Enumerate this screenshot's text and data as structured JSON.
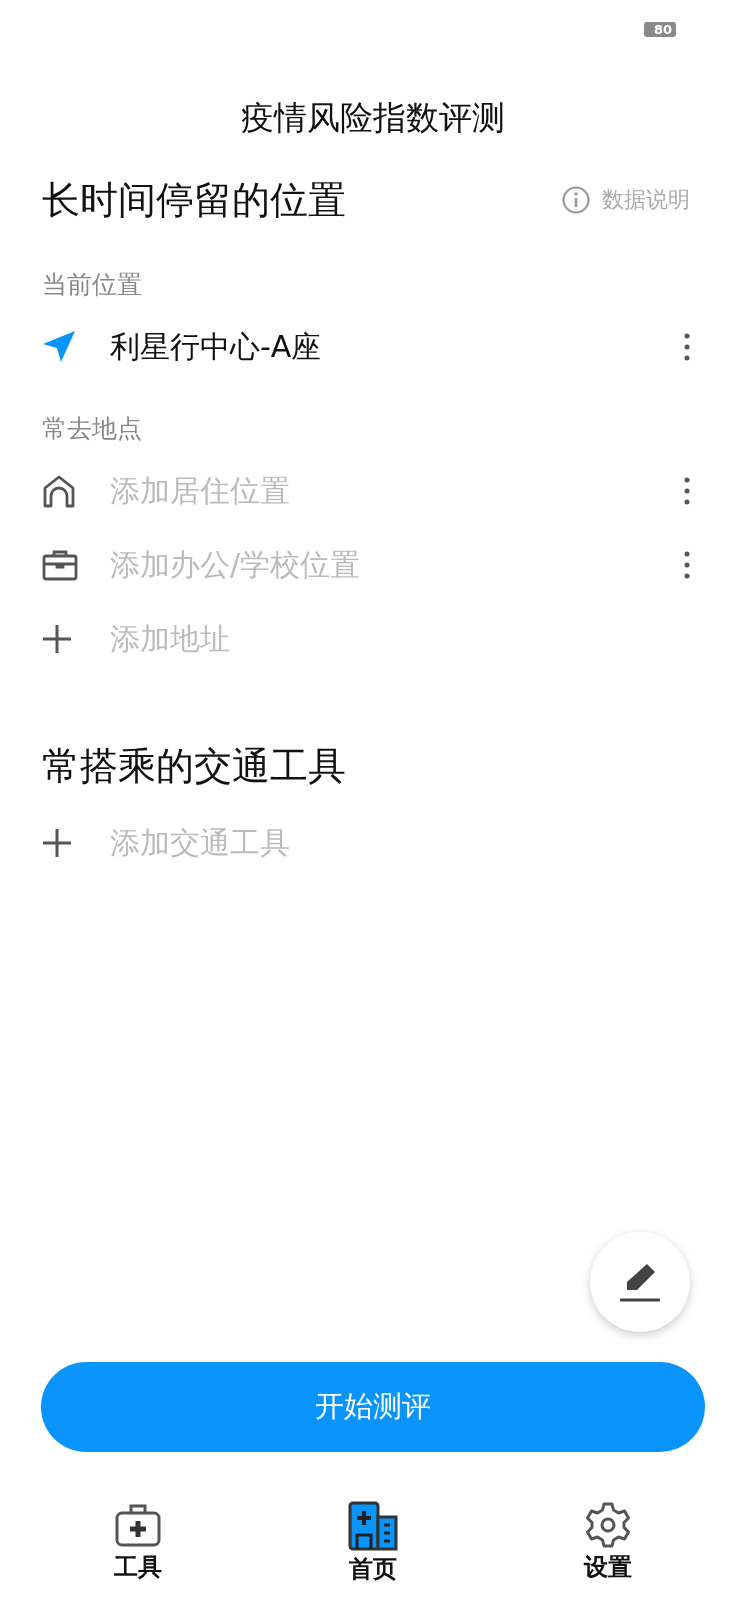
{
  "status_bar": {
    "battery": "80"
  },
  "title": "疫情风险指数评测",
  "locations": {
    "heading": "长时间停留的位置",
    "info_link": "数据说明",
    "current_label": "当前位置",
    "current": "利星行中心-A座",
    "frequent_label": "常去地点",
    "frequent": [
      {
        "kind": "home",
        "label": "添加居住位置"
      },
      {
        "kind": "work",
        "label": "添加办公/学校位置"
      },
      {
        "kind": "add",
        "label": "添加地址"
      }
    ]
  },
  "transport": {
    "heading": "常搭乘的交通工具",
    "items": [
      {
        "kind": "add",
        "label": "添加交通工具"
      }
    ]
  },
  "start_button": "开始测评",
  "tabs": [
    {
      "kind": "tools",
      "label": "工具",
      "selected": false
    },
    {
      "kind": "home",
      "label": "首页",
      "selected": true
    },
    {
      "kind": "settings",
      "label": "设置",
      "selected": false
    }
  ]
}
